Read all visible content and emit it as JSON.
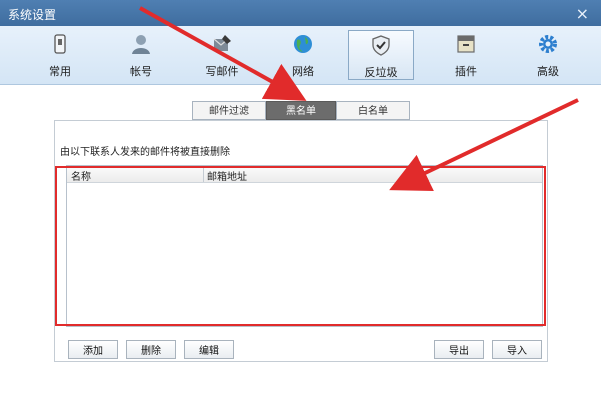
{
  "window": {
    "title": "系统设置",
    "close": "×"
  },
  "toolbar": {
    "items": [
      {
        "label": "常用",
        "icon": "common-settings-icon"
      },
      {
        "label": "帐号",
        "icon": "account-icon"
      },
      {
        "label": "写邮件",
        "icon": "compose-mail-icon"
      },
      {
        "label": "网络",
        "icon": "network-globe-icon"
      },
      {
        "label": "反垃圾",
        "icon": "anti-spam-shield-icon"
      },
      {
        "label": "插件",
        "icon": "plugin-box-icon"
      },
      {
        "label": "高级",
        "icon": "advanced-gear-icon"
      }
    ],
    "active_index": 4
  },
  "tabs": {
    "items": [
      {
        "label": "邮件过滤"
      },
      {
        "label": "黑名单"
      },
      {
        "label": "白名单"
      }
    ],
    "active_index": 1
  },
  "blacklist": {
    "description": "由以下联系人发来的邮件将被直接删除",
    "columns": {
      "name": "名称",
      "email": "邮箱地址"
    }
  },
  "buttons": {
    "add": "添加",
    "delete": "删除",
    "edit": "编辑",
    "export": "导出",
    "import": "导入"
  },
  "colors": {
    "titlebar": "#4878aa",
    "annotation_red": "#e12b2b",
    "toolbar_bg": "#dceaf7"
  }
}
